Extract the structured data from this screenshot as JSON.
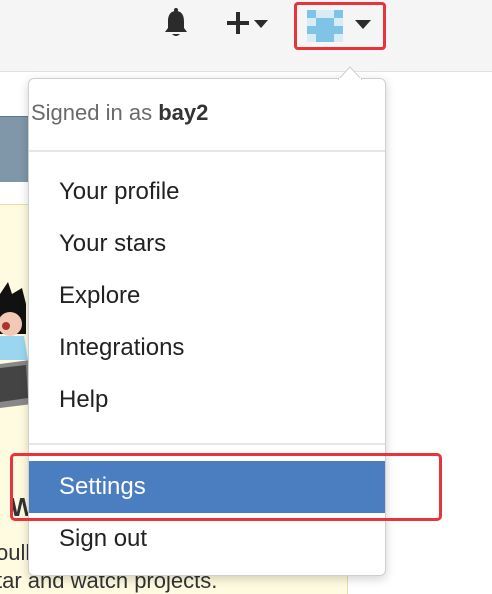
{
  "header": {
    "notifications_icon": "bell-icon",
    "create_icon": "plus-icon",
    "avatar_icon": "identicon-avatar"
  },
  "dropdown": {
    "signed_in_prefix": "Signed in as",
    "username": "bay2",
    "items": [
      {
        "label": "Your profile"
      },
      {
        "label": "Your stars"
      },
      {
        "label": "Explore"
      },
      {
        "label": "Integrations"
      },
      {
        "label": "Help"
      },
      {
        "label": "Settings"
      },
      {
        "label": "Sign out"
      }
    ]
  },
  "background": {
    "heading_fragment": "W",
    "text_line1": "oull",
    "text_line2": "tar and watch projects."
  },
  "colors": {
    "highlight": "#4b7ec1",
    "callout": "#e8333a"
  }
}
